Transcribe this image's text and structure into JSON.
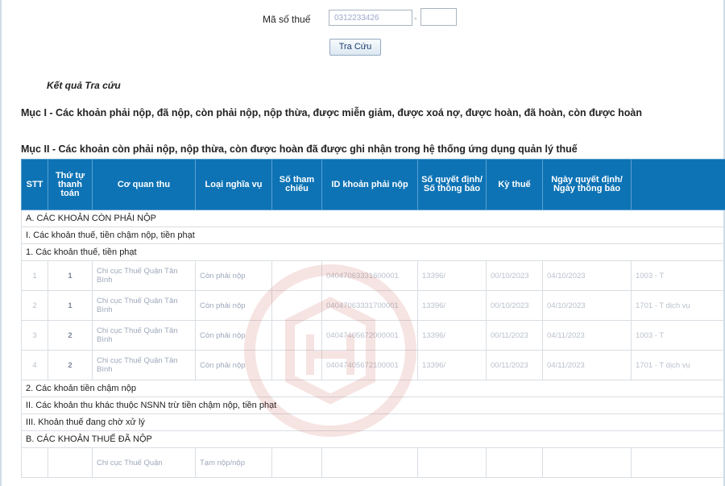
{
  "search": {
    "label": "Mã số thuế",
    "tax_code_value": "0312233426",
    "suffix_value": "",
    "button_label": "Tra Cứu"
  },
  "results": {
    "title": "Kết quả Tra cứu",
    "section1": "Mục I - Các khoản phải nộp, đã nộp, còn phải nộp, nộp thừa, được miễn giảm, được xoá nợ, được hoàn, đã hoàn, còn được hoàn",
    "section2": "Mục II - Các khoản còn phải nộp, nộp thừa, còn được hoàn đã được ghi nhận trong hệ thống ứng dụng quản lý thuế"
  },
  "table": {
    "headers": [
      "STT",
      "Thứ tự thanh toán",
      "Cơ quan thu",
      "Loại nghĩa vụ",
      "Số tham chiếu",
      "ID khoản phải nộp",
      "Số quyết định/ Số thông báo",
      "Kỳ thuế",
      "Ngày quyết định/ Ngày thông báo",
      ""
    ],
    "group_a": "A. CÁC KHOẢN CÒN PHẢI NỘP",
    "group_a_i": "I. Các khoản thuế, tiền chậm nộp, tiền phạt",
    "group_a_i_1": "1. Các khoản thuế, tiền phạt",
    "rows": [
      {
        "stt": "1",
        "order": "1",
        "agency": "Chi cục Thuế Quận Tân Bình",
        "obligation": "Còn phải nộp",
        "ref": "",
        "id": "04047063331600001",
        "decision": "13396/",
        "period": "00/10/2023",
        "date": "04/10/2023",
        "extra": "1003 - T"
      },
      {
        "stt": "2",
        "order": "1",
        "agency": "Chi cục Thuế Quận Tân Bình",
        "obligation": "Còn phải nộp",
        "ref": "",
        "id": "04047063331700001",
        "decision": "13396/",
        "period": "00/10/2023",
        "date": "04/10/2023",
        "extra": "1701 - T dịch vụ"
      },
      {
        "stt": "3",
        "order": "2",
        "agency": "Chi cục Thuế Quận Tân Bình",
        "obligation": "Còn phải nộp",
        "ref": "",
        "id": "04047405672000001",
        "decision": "13396/",
        "period": "00/11/2023",
        "date": "04/11/2023",
        "extra": "1003 - T"
      },
      {
        "stt": "4",
        "order": "2",
        "agency": "Chi cục Thuế Quận Tân Bình",
        "obligation": "Còn phải nộp",
        "ref": "",
        "id": "04047405672100001",
        "decision": "13396/",
        "period": "00/11/2023",
        "date": "04/11/2023",
        "extra": "1701 - T dịch vụ"
      }
    ],
    "group_a_i_2": "2. Các khoản tiền chậm nộp",
    "group_a_ii": "II. Các khoản thu khác thuộc NSNN trừ tiền chậm nộp, tiền phạt",
    "group_a_iii": "III. Khoản thuế đang chờ xử lý",
    "group_b": "B. CÁC KHOẢN THUẾ ĐÃ NỘP",
    "row_b1": {
      "agency": "Chi cục Thuế Quận",
      "obligation": "Tạm nộp/nộp"
    }
  },
  "colors": {
    "header_bg": "#0d73b5",
    "border": "#d9dee3"
  }
}
